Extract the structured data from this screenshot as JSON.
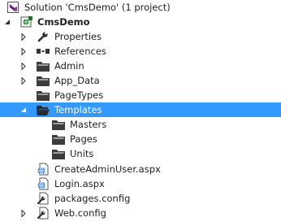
{
  "tree": {
    "solution_label": "Solution 'CmsDemo' (1 project)",
    "project_label": "CmsDemo",
    "items": {
      "properties": "Properties",
      "references": "References",
      "admin": "Admin",
      "app_data": "App_Data",
      "pagetypes": "PageTypes",
      "templates": "Templates",
      "masters": "Masters",
      "pages": "Pages",
      "units": "Units",
      "create_admin_user": "CreateAdminUser.aspx",
      "login": "Login.aspx",
      "packages_config": "packages.config",
      "web_config": "Web.config"
    },
    "icons": {
      "solution": "visual-studio-solution-icon",
      "project": "csharp-web-project-icon",
      "properties": "wrench-icon",
      "references": "references-icon",
      "folder": "folder-icon",
      "web_page": "globe-page-icon",
      "config": "config-file-icon"
    },
    "colors": {
      "selection": "#3399ff",
      "text": "#1e1e1e",
      "folder": "#3c3c3c"
    }
  }
}
